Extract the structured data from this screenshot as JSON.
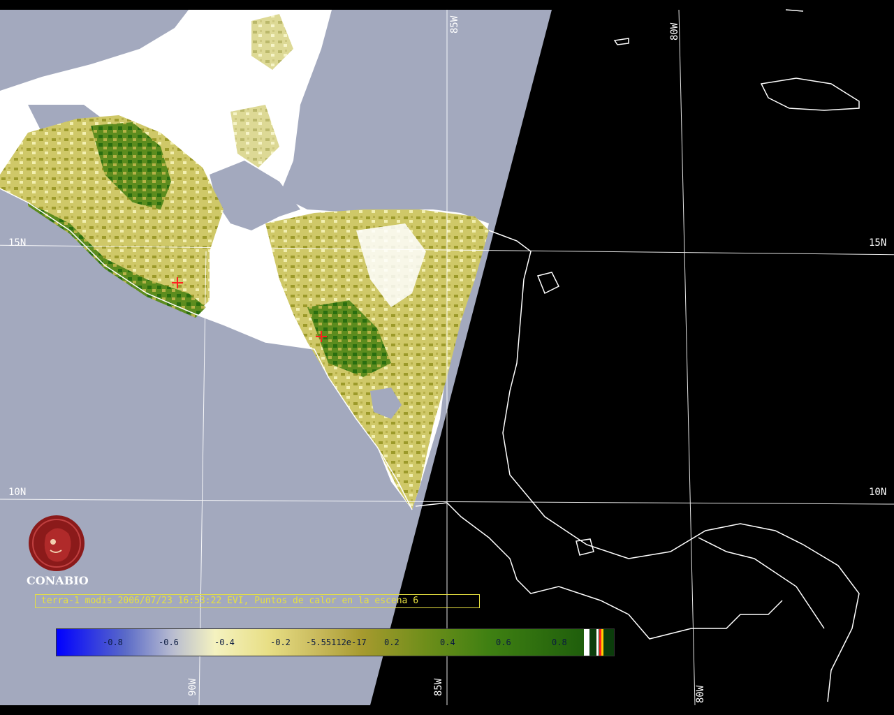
{
  "colors": {
    "ocean_day": "#a3a9be",
    "night": "#000000",
    "coast": "#ffffff",
    "cloud": "#ffffff",
    "veg_low": "#d8d26a",
    "veg_mid": "#9c9a2a",
    "veg_high": "#2f7a12",
    "fire": "#ff2020",
    "caption": "#e6e040",
    "logo": "#8b1a1a"
  },
  "grid_labels": {
    "lon_85w_top": "85W",
    "lon_80w_top": "80W",
    "lat_15n_left": "15N",
    "lat_15n_right": "15N",
    "lat_10n_left": "10N",
    "lat_10n_right": "10N",
    "lon_90w_bottom": "90W",
    "lon_85w_bottom": "85W",
    "lon_80w_bottom": "80W"
  },
  "logo": {
    "icon": "conabio-logo-icon",
    "text": "CONABIO"
  },
  "caption": "terra-1 modis 2006/07/23 16:53:22 EVI, Puntos de calor en la escena 6",
  "colorbar": {
    "ticks": [
      "-0.8",
      "-0.6",
      "-0.4",
      "-0.2",
      "-5.55112e-17",
      "0.2",
      "0.4",
      "0.6",
      "0.8"
    ]
  }
}
